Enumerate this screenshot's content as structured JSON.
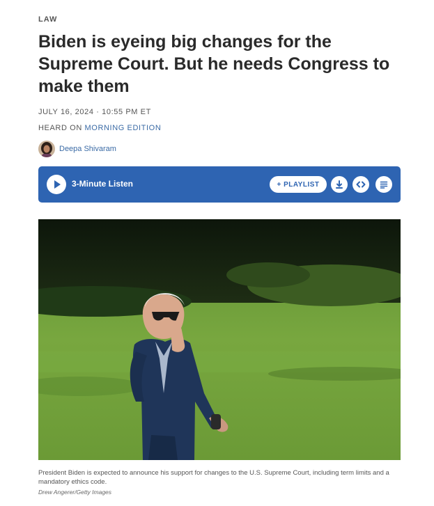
{
  "article": {
    "slug": "LAW",
    "headline": "Biden is eyeing big changes for the Supreme Court. But he needs Congress to make them",
    "dateline": "JULY 16, 2024 · 10:55 PM ET",
    "heard_prefix": "HEARD ON ",
    "heard_show": "MORNING EDITION",
    "author": "Deepa Shivaram"
  },
  "player": {
    "listen_label": "3-Minute Listen",
    "playlist_label": "+ PLAYLIST",
    "icons": [
      "play-icon",
      "download-icon",
      "embed-icon",
      "transcript-icon"
    ],
    "accent_color": "#2e64b2"
  },
  "photo": {
    "caption": "President Biden is expected to announce his support for changes to the U.S. Supreme Court, including term limits and a mandatory ethics code.",
    "credit": "Drew Angerer/Getty Images"
  }
}
